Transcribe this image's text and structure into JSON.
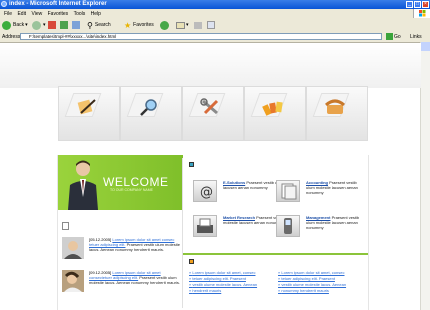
{
  "browser": {
    "title": "index - Microsoft Internet Explorer",
    "window_buttons": [
      "_",
      "□",
      "×"
    ],
    "menu": [
      "File",
      "Edit",
      "View",
      "Favorites",
      "Tools",
      "Help"
    ],
    "toolbar": {
      "back": "Back",
      "search": "Search",
      "favorites": "Favorites"
    },
    "address": {
      "label": "Address",
      "value": "F:\\templates\\tmpl-##\\xxxxx...\\site\\index.html",
      "go": "Go",
      "links": "Links"
    }
  },
  "page": {
    "nav_icons": [
      {
        "name": "pencil-notes-icon"
      },
      {
        "name": "magnifier-icon"
      },
      {
        "name": "tools-icon"
      },
      {
        "name": "color-swatches-icon"
      },
      {
        "name": "telephone-icon"
      }
    ],
    "welcome": {
      "title": "WELCOME",
      "subtitle": "TO OUR COMPANY NAME"
    },
    "news": [
      {
        "date": "[05.12.2005]",
        "link": "Lorem ipsum dolor sit amet consec tetuer adipiscing elit.",
        "body": "Praesent vestib ulum molestie lacus. Aenean nonummy hendrerit mauris."
      },
      {
        "date": "[09.12.2005]",
        "link": "Lorem ipsum dolor sit amet consectetuer adipiscing elit.",
        "body": "Praesent vestib ulum molestie lacus. Aenean nonummy hendrerit mauris."
      }
    ],
    "services": [
      {
        "title": "E-Solutions",
        "text": "Praesent vestib ulum molestie lacusen aenan nonummy",
        "icon": "at-sign-icon"
      },
      {
        "title": "Accounting",
        "text": "Praesent vestib ulum molestie lacusen aenan nonummy",
        "icon": "papers-icon"
      },
      {
        "title": "Market Research",
        "text": "Praesent vestib ulum molestie lacusen aenan nonummy",
        "icon": "typewriter-icon"
      },
      {
        "title": "Management",
        "text": "Praesent vestib ulum molestie lacusen aenan nonummy",
        "icon": "mobile-phone-icon"
      }
    ],
    "links_left": [
      "Lorem ipsum dolor sit amet, consec",
      "tetuer adipiscing elit. Praesent",
      "vestib ulume molestie lacus. Aenean",
      "hendrerit mauris"
    ],
    "links_right": [
      "Lorem ipsum dolor sit amet, consec",
      "tetuer adipiscing elit. Praesent",
      "vestib ulume molestie lacus. Aenean",
      "nonummy hendrerit mauris"
    ],
    "colors": {
      "accent_green": "#8bc43a",
      "link_blue": "#2f6fd6",
      "title_blue": "#1d4fa7"
    }
  }
}
